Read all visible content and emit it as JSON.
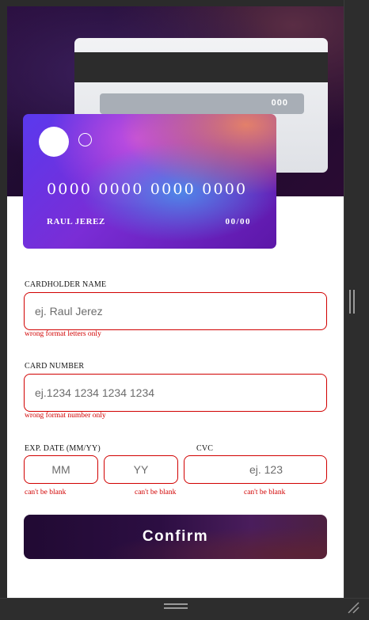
{
  "card_back": {
    "cvc": "000"
  },
  "card_front": {
    "number": "0000 0000 0000 0000",
    "name": "RAUL JEREZ",
    "expiry": "00/00"
  },
  "form": {
    "cardholder": {
      "label": "CARDHOLDER NAME",
      "placeholder": "ej. Raul Jerez",
      "error": "wrong format letters only"
    },
    "number": {
      "label": "CARD NUMBER",
      "placeholder": "ej.1234 1234 1234 1234",
      "error": "wrong format number only"
    },
    "expiry": {
      "label": "EXP. DATE (MM/YY)",
      "month_placeholder": "MM",
      "year_placeholder": "YY",
      "month_error": "can't be blank",
      "year_error": "can't be blank"
    },
    "cvc": {
      "label": "CVC",
      "placeholder": "ej. 123",
      "error": "can't be blank"
    },
    "confirm_label": "Confirm"
  },
  "colors": {
    "error": "#d10000",
    "button_dark": "#210a33",
    "card_purple": "#5a39ee"
  }
}
